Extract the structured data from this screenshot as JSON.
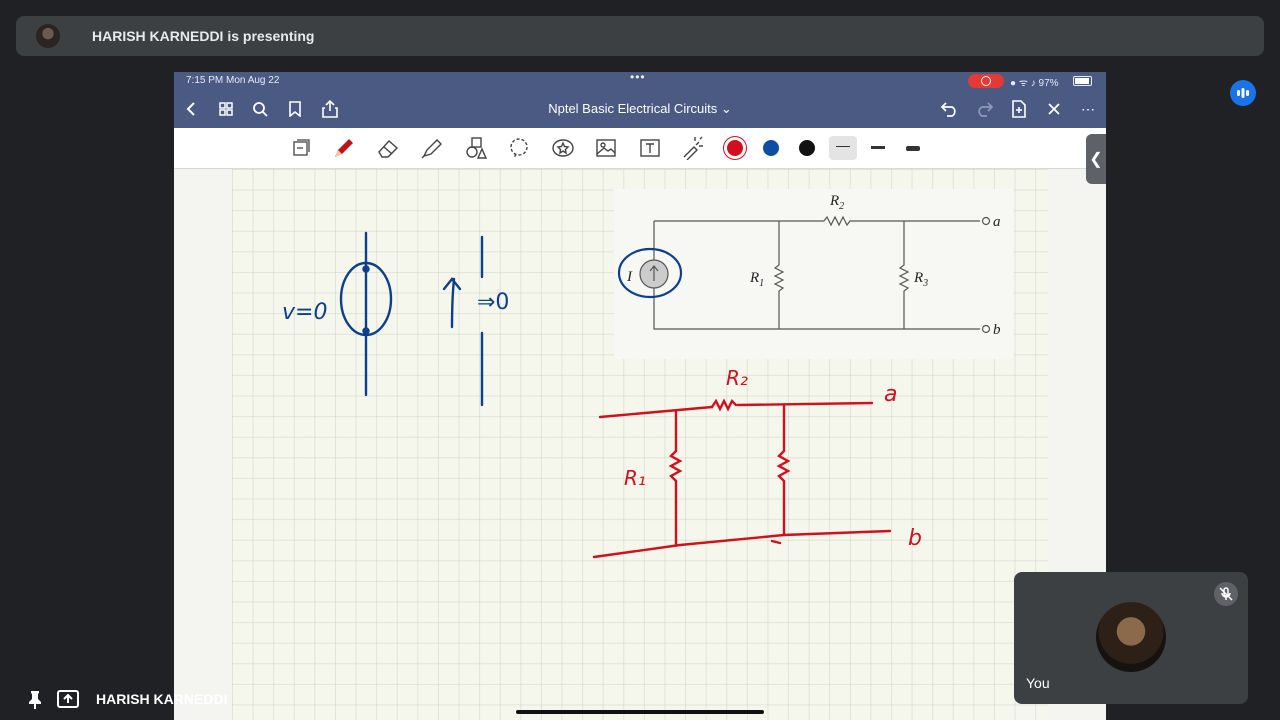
{
  "banner": {
    "text": "HARISH KARNEDDI is presenting"
  },
  "ipad": {
    "status": {
      "time": "7:15 PM   Mon Aug 22",
      "battery": "97%"
    },
    "nav": {
      "title": "Nptel Basic Electrical Circuits ⌄"
    },
    "toolbar": {
      "colors": [
        "#d0101e",
        "#0e4ea0",
        "#111111"
      ],
      "icons": [
        "pages-icon",
        "pen-icon",
        "eraser-icon",
        "highlighter-icon",
        "shapes-icon",
        "lasso-icon",
        "sticker-icon",
        "image-icon",
        "textbox-icon",
        "laser-icon"
      ]
    },
    "sidetab_glyph": "❮"
  },
  "textbook_circuit": {
    "labels": {
      "r2": "R",
      "r2_sub": "2",
      "r1": "R",
      "r1_sub": "1",
      "r3": "R",
      "r3_sub": "3",
      "a": "a",
      "b": "b",
      "source": "I"
    }
  },
  "handwriting": {
    "left_note": "v=0",
    "middle_note": "⇒0",
    "red_r2": "R₂",
    "red_r1": "R₁",
    "red_a": "a",
    "red_b": "b"
  },
  "bottom": {
    "presenter_name": "HARISH KARNEDDI"
  },
  "self_tile": {
    "name": "You"
  },
  "colors": {
    "ink_blue": "#0e3f8a",
    "ink_red": "#d0101e",
    "header": "#4a5a82"
  }
}
